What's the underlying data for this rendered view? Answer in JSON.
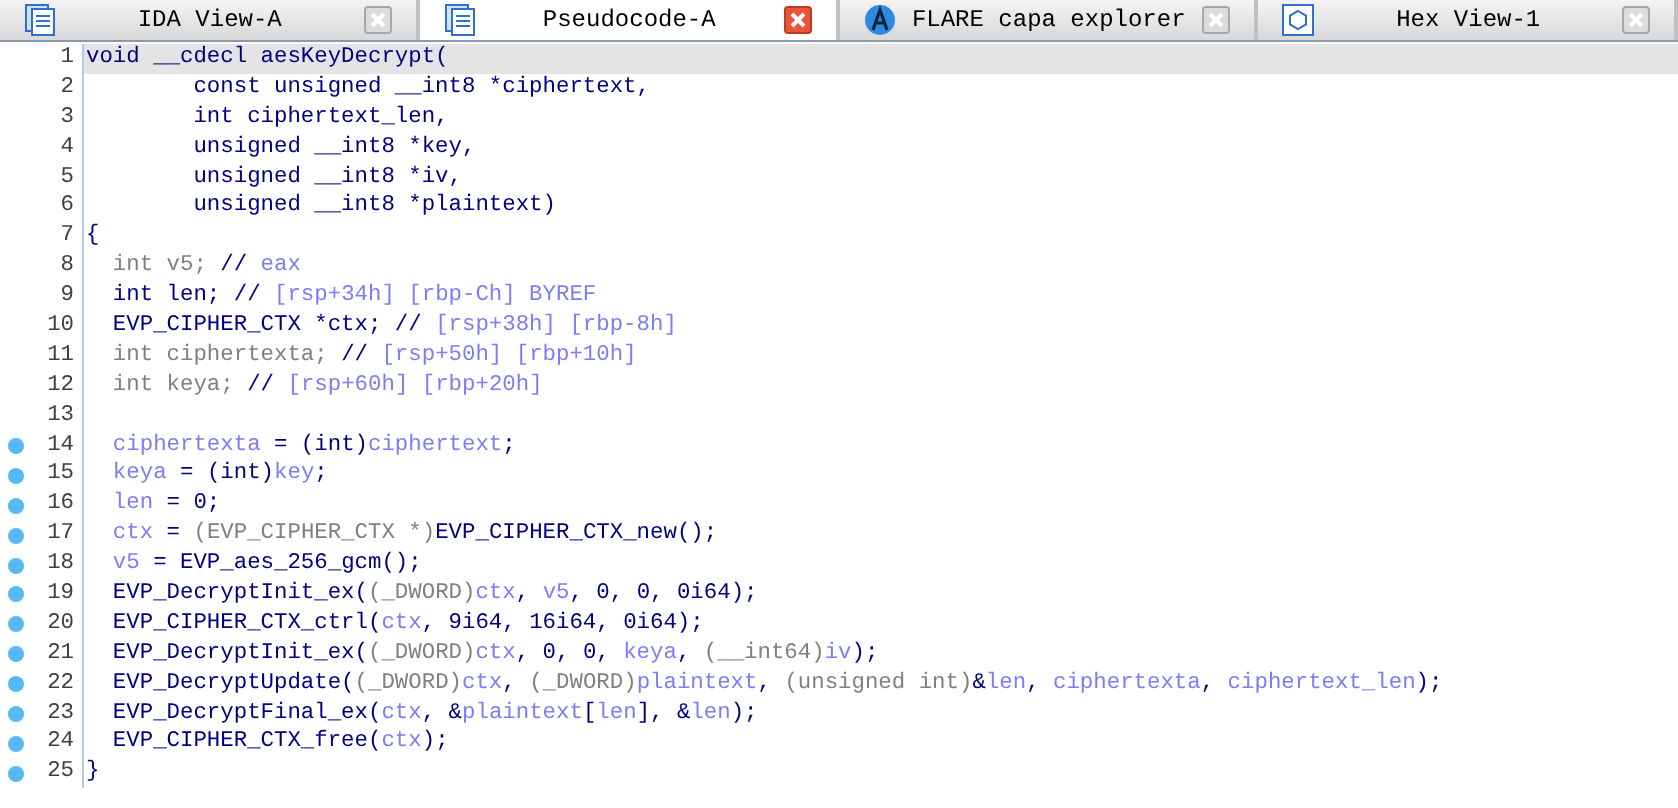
{
  "tabs": [
    {
      "label": "IDA View-A",
      "selected": false,
      "kind": "disasm"
    },
    {
      "label": "Pseudocode-A",
      "selected": true,
      "kind": "pseudo"
    },
    {
      "label": "FLARE capa explorer",
      "selected": false,
      "kind": "capa"
    },
    {
      "label": "Hex View-1",
      "selected": false,
      "kind": "hex"
    }
  ],
  "code": [
    {
      "number": "1",
      "selected": true,
      "breakpoint": false,
      "segments": [
        {
          "text": "void __cdecl aesKeyDecrypt(",
          "kind": "plain"
        }
      ]
    },
    {
      "number": "2",
      "selected": false,
      "breakpoint": false,
      "segments": [
        {
          "text": "        const unsigned __int8 *ciphertext,",
          "kind": "plain"
        }
      ]
    },
    {
      "number": "3",
      "selected": false,
      "breakpoint": false,
      "segments": [
        {
          "text": "        int ciphertext_len,",
          "kind": "plain"
        }
      ]
    },
    {
      "number": "4",
      "selected": false,
      "breakpoint": false,
      "segments": [
        {
          "text": "        unsigned __int8 *key,",
          "kind": "plain"
        }
      ]
    },
    {
      "number": "5",
      "selected": false,
      "breakpoint": false,
      "segments": [
        {
          "text": "        unsigned __int8 *iv,",
          "kind": "plain"
        }
      ]
    },
    {
      "number": "6",
      "selected": false,
      "breakpoint": false,
      "segments": [
        {
          "text": "        unsigned __int8 *plaintext)",
          "kind": "plain"
        }
      ]
    },
    {
      "number": "7",
      "selected": false,
      "breakpoint": false,
      "segments": [
        {
          "text": "{",
          "kind": "plain"
        }
      ]
    },
    {
      "number": "8",
      "selected": false,
      "breakpoint": false,
      "segments": [
        {
          "text": "  int v5; ",
          "kind": "gray"
        },
        {
          "text": "// ",
          "kind": "plain"
        },
        {
          "text": "eax",
          "kind": "var"
        }
      ]
    },
    {
      "number": "9",
      "selected": false,
      "breakpoint": false,
      "segments": [
        {
          "text": "  int len; // ",
          "kind": "plain"
        },
        {
          "text": "[rsp+34h] [rbp-Ch] BYREF",
          "kind": "var"
        }
      ]
    },
    {
      "number": "10",
      "selected": false,
      "breakpoint": false,
      "segments": [
        {
          "text": "  EVP_CIPHER_CTX *ctx; // ",
          "kind": "plain"
        },
        {
          "text": "[rsp+38h] [rbp-8h]",
          "kind": "var"
        }
      ]
    },
    {
      "number": "11",
      "selected": false,
      "breakpoint": false,
      "segments": [
        {
          "text": "  int ciphertexta; ",
          "kind": "gray"
        },
        {
          "text": "// ",
          "kind": "plain"
        },
        {
          "text": "[rsp+50h] [rbp+10h]",
          "kind": "var"
        }
      ]
    },
    {
      "number": "12",
      "selected": false,
      "breakpoint": false,
      "segments": [
        {
          "text": "  int keya; ",
          "kind": "gray"
        },
        {
          "text": "// ",
          "kind": "plain"
        },
        {
          "text": "[rsp+60h] [rbp+20h]",
          "kind": "var"
        }
      ]
    },
    {
      "number": "13",
      "selected": false,
      "breakpoint": false
    },
    {
      "number": "14",
      "selected": false,
      "breakpoint": true,
      "segments": [
        {
          "text": "  ciphertexta",
          "kind": "var"
        },
        {
          "text": " = (int)",
          "kind": "plain"
        },
        {
          "text": "ciphertext",
          "kind": "var"
        },
        {
          "text": ";",
          "kind": "plain"
        }
      ]
    },
    {
      "number": "15",
      "selected": false,
      "breakpoint": true,
      "segments": [
        {
          "text": "  keya",
          "kind": "var"
        },
        {
          "text": " = (int)",
          "kind": "plain"
        },
        {
          "text": "key",
          "kind": "var"
        },
        {
          "text": ";",
          "kind": "plain"
        }
      ]
    },
    {
      "number": "16",
      "selected": false,
      "breakpoint": true,
      "segments": [
        {
          "text": "  len",
          "kind": "var"
        },
        {
          "text": " = 0;",
          "kind": "plain"
        }
      ]
    },
    {
      "number": "17",
      "selected": false,
      "breakpoint": true,
      "segments": [
        {
          "text": "  ctx",
          "kind": "var"
        },
        {
          "text": " = ",
          "kind": "plain"
        },
        {
          "text": "(EVP_CIPHER_CTX *)",
          "kind": "gray"
        },
        {
          "text": "EVP_CIPHER_CTX_new();",
          "kind": "plain"
        }
      ]
    },
    {
      "number": "18",
      "selected": false,
      "breakpoint": true,
      "segments": [
        {
          "text": "  v5",
          "kind": "var"
        },
        {
          "text": " = EVP_aes_256_gcm();",
          "kind": "plain"
        }
      ]
    },
    {
      "number": "19",
      "selected": false,
      "breakpoint": true,
      "segments": [
        {
          "text": "  EVP_DecryptInit_ex(",
          "kind": "plain"
        },
        {
          "text": "(_DWORD)",
          "kind": "gray"
        },
        {
          "text": "ctx",
          "kind": "var"
        },
        {
          "text": ", ",
          "kind": "plain"
        },
        {
          "text": "v5",
          "kind": "var"
        },
        {
          "text": ", 0, 0, 0i64);",
          "kind": "plain"
        }
      ]
    },
    {
      "number": "20",
      "selected": false,
      "breakpoint": true,
      "segments": [
        {
          "text": "  EVP_CIPHER_CTX_ctrl(",
          "kind": "plain"
        },
        {
          "text": "ctx",
          "kind": "var"
        },
        {
          "text": ", 9i64, 16i64, 0i64);",
          "kind": "plain"
        }
      ]
    },
    {
      "number": "21",
      "selected": false,
      "breakpoint": true,
      "segments": [
        {
          "text": "  EVP_DecryptInit_ex(",
          "kind": "plain"
        },
        {
          "text": "(_DWORD)",
          "kind": "gray"
        },
        {
          "text": "ctx",
          "kind": "var"
        },
        {
          "text": ", 0, 0, ",
          "kind": "plain"
        },
        {
          "text": "keya",
          "kind": "var"
        },
        {
          "text": ", ",
          "kind": "plain"
        },
        {
          "text": "(__int64)",
          "kind": "gray"
        },
        {
          "text": "iv",
          "kind": "var"
        },
        {
          "text": ");",
          "kind": "plain"
        }
      ]
    },
    {
      "number": "22",
      "selected": false,
      "breakpoint": true,
      "segments": [
        {
          "text": "  EVP_DecryptUpdate(",
          "kind": "plain"
        },
        {
          "text": "(_DWORD)",
          "kind": "gray"
        },
        {
          "text": "ctx",
          "kind": "var"
        },
        {
          "text": ", ",
          "kind": "plain"
        },
        {
          "text": "(_DWORD)",
          "kind": "gray"
        },
        {
          "text": "plaintext",
          "kind": "var"
        },
        {
          "text": ", ",
          "kind": "plain"
        },
        {
          "text": "(unsigned int)",
          "kind": "gray"
        },
        {
          "text": "&",
          "kind": "plain"
        },
        {
          "text": "len",
          "kind": "var"
        },
        {
          "text": ", ",
          "kind": "plain"
        },
        {
          "text": "ciphertexta",
          "kind": "var"
        },
        {
          "text": ", ",
          "kind": "plain"
        },
        {
          "text": "ciphertext_len",
          "kind": "var"
        },
        {
          "text": ");",
          "kind": "plain"
        }
      ]
    },
    {
      "number": "23",
      "selected": false,
      "breakpoint": true,
      "segments": [
        {
          "text": "  EVP_DecryptFinal_ex(",
          "kind": "plain"
        },
        {
          "text": "ctx",
          "kind": "var"
        },
        {
          "text": ", &",
          "kind": "plain"
        },
        {
          "text": "plaintext",
          "kind": "var"
        },
        {
          "text": "[",
          "kind": "plain"
        },
        {
          "text": "len",
          "kind": "var"
        },
        {
          "text": "], &",
          "kind": "plain"
        },
        {
          "text": "len",
          "kind": "var"
        },
        {
          "text": ");",
          "kind": "plain"
        }
      ]
    },
    {
      "number": "24",
      "selected": false,
      "breakpoint": true,
      "segments": [
        {
          "text": "  EVP_CIPHER_CTX_free(",
          "kind": "plain"
        },
        {
          "text": "ctx",
          "kind": "var"
        },
        {
          "text": ");",
          "kind": "plain"
        }
      ]
    },
    {
      "number": "25",
      "selected": false,
      "breakpoint": true,
      "segments": [
        {
          "text": "}",
          "kind": "plain"
        }
      ]
    }
  ]
}
